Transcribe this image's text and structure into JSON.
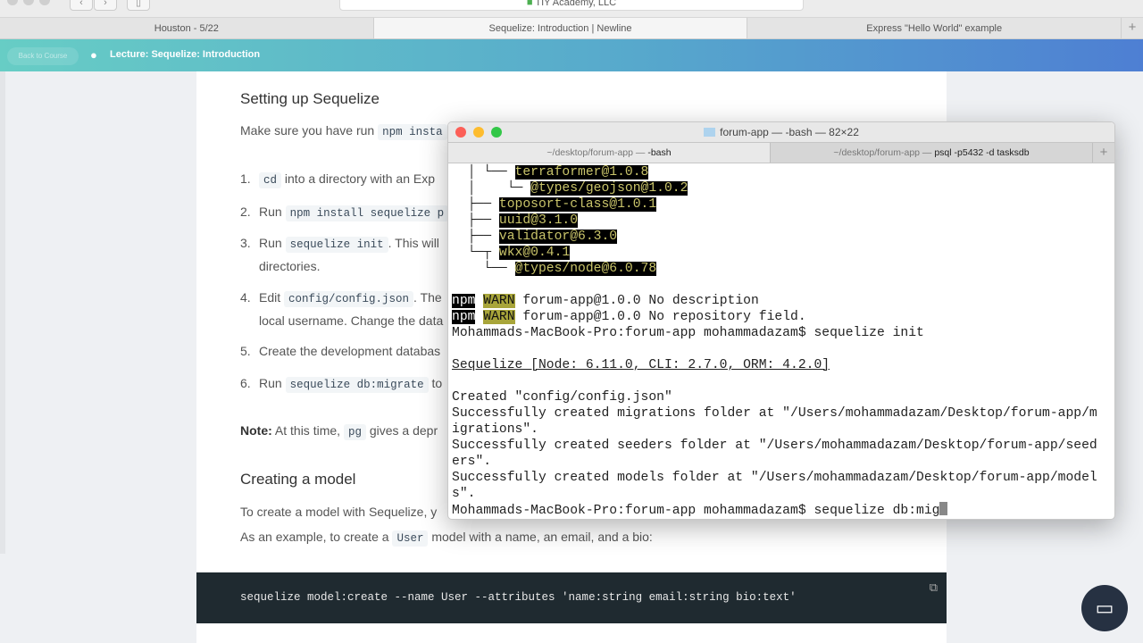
{
  "browser": {
    "address": "TIY Academy, LLC",
    "tabs": [
      "Houston - 5/22",
      "Sequelize: Introduction | Newline",
      "Express \"Hello World\" example"
    ],
    "active_tab": 1
  },
  "banner": {
    "back": "Back to Course",
    "lecture": "Lecture: Sequelize: Introduction"
  },
  "article": {
    "h1": "Setting up Sequelize",
    "intro_text": "Make sure you have run",
    "intro_code": "npm insta",
    "steps": [
      {
        "n": "1.",
        "pre": "",
        "code": "cd",
        "post": "into a directory with an Exp"
      },
      {
        "n": "2.",
        "pre": "Run",
        "code": "npm install sequelize p",
        "post": ""
      },
      {
        "n": "3.",
        "pre": "Run",
        "code": "sequelize init",
        "post": ". This will",
        "cont": "directories."
      },
      {
        "n": "4.",
        "pre": "Edit",
        "code": "config/config.json",
        "post": ". The",
        "cont": "local username. Change the data"
      },
      {
        "n": "5.",
        "pre": "Create the development databas",
        "code": "",
        "post": ""
      },
      {
        "n": "6.",
        "pre": "Run",
        "code": "sequelize db:migrate",
        "post": "to"
      }
    ],
    "note_label": "Note:",
    "note_text": "At this time,",
    "note_code": "pg",
    "note_post": "gives a depr",
    "h2": "Creating a model",
    "p2": "To create a model with Sequelize, y",
    "p3_pre": "As an example, to create a",
    "p3_code": "User",
    "p3_post": "model with a name, an email, and a bio:",
    "codeblock": "sequelize model:create --name User --attributes 'name:string email:string bio:text'"
  },
  "terminal": {
    "title": "forum-app — -bash — 82×22",
    "tabs": [
      {
        "path": "~/desktop/forum-app — ",
        "cmd": "-bash"
      },
      {
        "path": "~/desktop/forum-app — ",
        "cmd": "psql -p5432 -d tasksdb"
      }
    ],
    "tree": [
      {
        "prefix": "  │ └── ",
        "pkg": "terraformer@1.0.8"
      },
      {
        "prefix": "  │    └─ ",
        "pkg": "@types/geojson@1.0.2"
      },
      {
        "prefix": "  ├── ",
        "pkg": "toposort-class@1.0.1"
      },
      {
        "prefix": "  ├── ",
        "pkg": "uuid@3.1.0"
      },
      {
        "prefix": "  ├── ",
        "pkg": "validator@6.3.0"
      },
      {
        "prefix": "  └─┬ ",
        "pkg": "wkx@0.4.1"
      },
      {
        "prefix": "    └── ",
        "pkg": "@types/node@6.0.78"
      }
    ],
    "warn1": " forum-app@1.0.0 No description",
    "warn2": " forum-app@1.0.0 No repository field.",
    "npm": "npm",
    "warn": "WARN",
    "prompt1": "Mohammads-MacBook-Pro:forum-app mohammadazam$ sequelize init",
    "banner": "Sequelize [Node: 6.11.0, CLI: 2.7.0, ORM: 4.2.0]",
    "out": [
      "Created \"config/config.json\"",
      "Successfully created migrations folder at \"/Users/mohammadazam/Desktop/forum-app/m",
      "igrations\".",
      "Successfully created seeders folder at \"/Users/mohammadazam/Desktop/forum-app/seed",
      "ers\".",
      "Successfully created models folder at \"/Users/mohammadazam/Desktop/forum-app/model",
      "s\"."
    ],
    "prompt2": "Mohammads-MacBook-Pro:forum-app mohammadazam$ sequelize db:mig"
  }
}
